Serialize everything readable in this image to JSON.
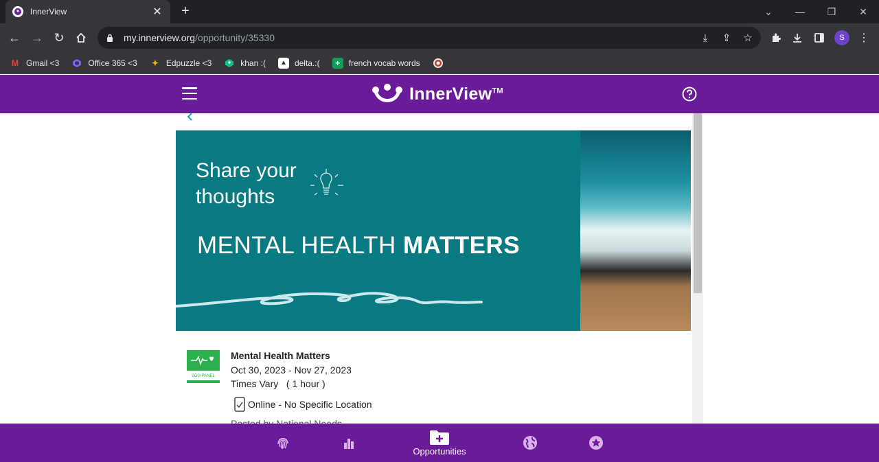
{
  "browser": {
    "tab_title": "InnerView",
    "url_domain": "my.innerview.org",
    "url_path": "/opportunity/35330",
    "profile_initial": "S",
    "bookmarks": [
      {
        "label": "Gmail <3",
        "icon": "gmail-icon",
        "color": "#ea4335"
      },
      {
        "label": "Office 365 <3",
        "icon": "office-icon",
        "color": "#7b61ff"
      },
      {
        "label": "Edpuzzle <3",
        "icon": "edpuzzle-icon",
        "color": "#f4b400"
      },
      {
        "label": "khan :(",
        "icon": "khan-icon",
        "color": "#14bf96"
      },
      {
        "label": "delta.:(",
        "icon": "delta-icon",
        "color": "#ffffff"
      },
      {
        "label": "french vocab words",
        "icon": "sheets-icon",
        "color": "#0f9d58"
      }
    ]
  },
  "app": {
    "brand": "InnerView",
    "trademark": "TM",
    "accent": "#6a1b9a"
  },
  "banner": {
    "headline": "Share your thoughts",
    "headline_line1": "Share your",
    "headline_line2": "thoughts",
    "subhead_light": "MENTAL HEALTH",
    "subhead_bold": "MATTERS"
  },
  "opportunity": {
    "badge_text": "SDG PANEL",
    "title": "Mental Health Matters",
    "dates": "Oct 30, 2023 - Nov 27, 2023",
    "times": "Times Vary   ( 1 hour )",
    "location": "Online - No Specific Location",
    "posted_by": "Posted by National Needs..."
  },
  "bottom_nav": {
    "items": [
      {
        "name": "fingerprint-icon",
        "label": ""
      },
      {
        "name": "bar-chart-icon",
        "label": ""
      },
      {
        "name": "add-folder-icon",
        "label": "Opportunities"
      },
      {
        "name": "globe-icon",
        "label": ""
      },
      {
        "name": "star-icon",
        "label": ""
      }
    ],
    "active_label": "Opportunities"
  }
}
